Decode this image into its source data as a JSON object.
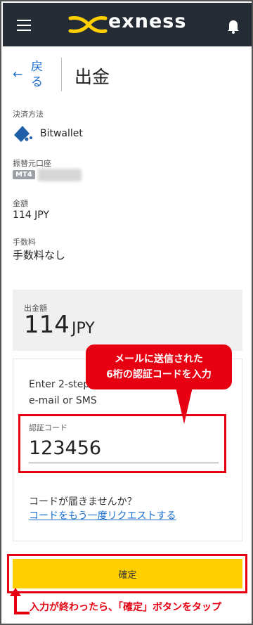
{
  "header": {
    "brand": "exness"
  },
  "nav": {
    "back_label": "戻る",
    "title": "出金"
  },
  "details": {
    "method_label": "決済方法",
    "method_value": "Bitwallet",
    "account_label": "振替元口座",
    "account_badge": "MT4",
    "amount_label": "金額",
    "amount_value": "114 JPY",
    "fee_label": "手数料",
    "fee_value": "手数料なし"
  },
  "summary": {
    "label": "出金額",
    "amount": "114",
    "currency": "JPY"
  },
  "verification": {
    "line1": "Enter 2-step",
    "line2": "e-mail or SMS",
    "code_label": "認証コード",
    "code_value": "123456",
    "not_received": "コードが届きませんか？",
    "resend_link": "コードをもう一度リクエストする"
  },
  "actions": {
    "confirm_label": "確定"
  },
  "annotations": {
    "callout_line1": "メールに送信された",
    "callout_line2": "6桁の認証コードを入力",
    "bottom_note": "入力が終わったら、「確定」ボタンをタップ"
  },
  "colors": {
    "header_bg": "#252c35",
    "brand_yellow": "#ffcf00",
    "link_blue": "#1d6fcf",
    "annotation_red": "#e60012"
  },
  "icons": [
    "menu-icon",
    "exness-logo-icon",
    "bell-icon",
    "back-arrow-icon",
    "bitwallet-icon"
  ]
}
